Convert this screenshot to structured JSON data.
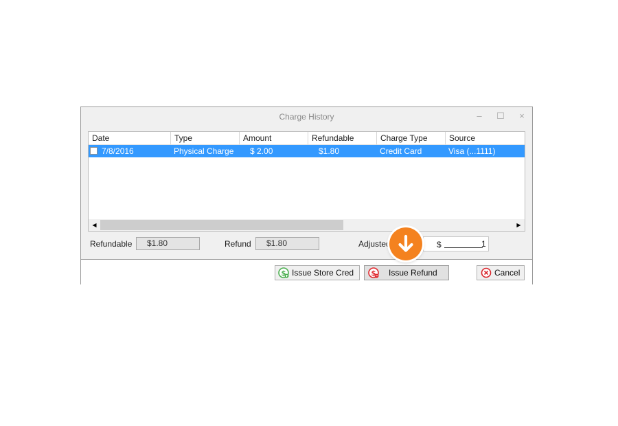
{
  "window": {
    "title": "Charge History",
    "controls": {
      "minimize": "–",
      "maximize": "☐",
      "close": "×"
    }
  },
  "grid": {
    "columns": [
      "Date",
      "Type",
      "Amount",
      "Refundable",
      "Charge Type",
      "Source"
    ],
    "rows": [
      {
        "checked": false,
        "selected": true,
        "cells": [
          "7/8/2016",
          "Physical Charge",
          "$ 2.00",
          "$1.80",
          "Credit Card",
          "Visa (...1111)"
        ]
      }
    ],
    "scroll": {
      "left_arrow": "◀",
      "right_arrow": "▶"
    }
  },
  "summary": {
    "refundable_label": "Refundable",
    "refundable_value": "$1.80",
    "refund_label": "Refund",
    "refund_value": "$1.80",
    "adjusted_label": "Adjusted",
    "adjusted_currency": "$",
    "adjusted_value": "1"
  },
  "buttons": {
    "store_credit": {
      "label": "Issue  Store Cred",
      "icon": "store-credit-icon"
    },
    "refund": {
      "label": "Issue Refund",
      "icon": "refund-icon"
    },
    "cancel": {
      "label": "Cancel",
      "icon": "cancel-icon"
    }
  },
  "hint": {
    "icon": "arrow-down-icon"
  },
  "colors": {
    "selection": "#3399ff",
    "hint": "#f4821f",
    "cancel_icon": "#d9262c",
    "refund_icon": "#e0282e",
    "store_icon": "#4caf50"
  }
}
